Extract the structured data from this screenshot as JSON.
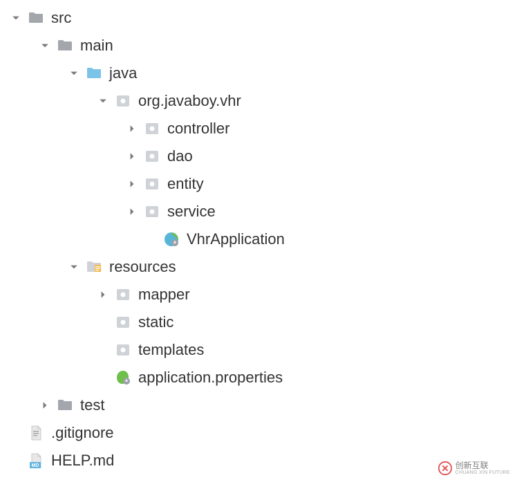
{
  "tree": {
    "src": "src",
    "main": "main",
    "java": "java",
    "pkg": "org.javaboy.vhr",
    "controller": "controller",
    "dao": "dao",
    "entity": "entity",
    "service": "service",
    "vhrApp": "VhrApplication",
    "resources": "resources",
    "mapper": "mapper",
    "static": "static",
    "templates": "templates",
    "appProps": "application.properties",
    "test": "test",
    "gitignore": ".gitignore",
    "helpmd": "HELP.md"
  },
  "watermark": {
    "brand": "创新互联",
    "sub": "CHUANG XIN FUTURE"
  }
}
